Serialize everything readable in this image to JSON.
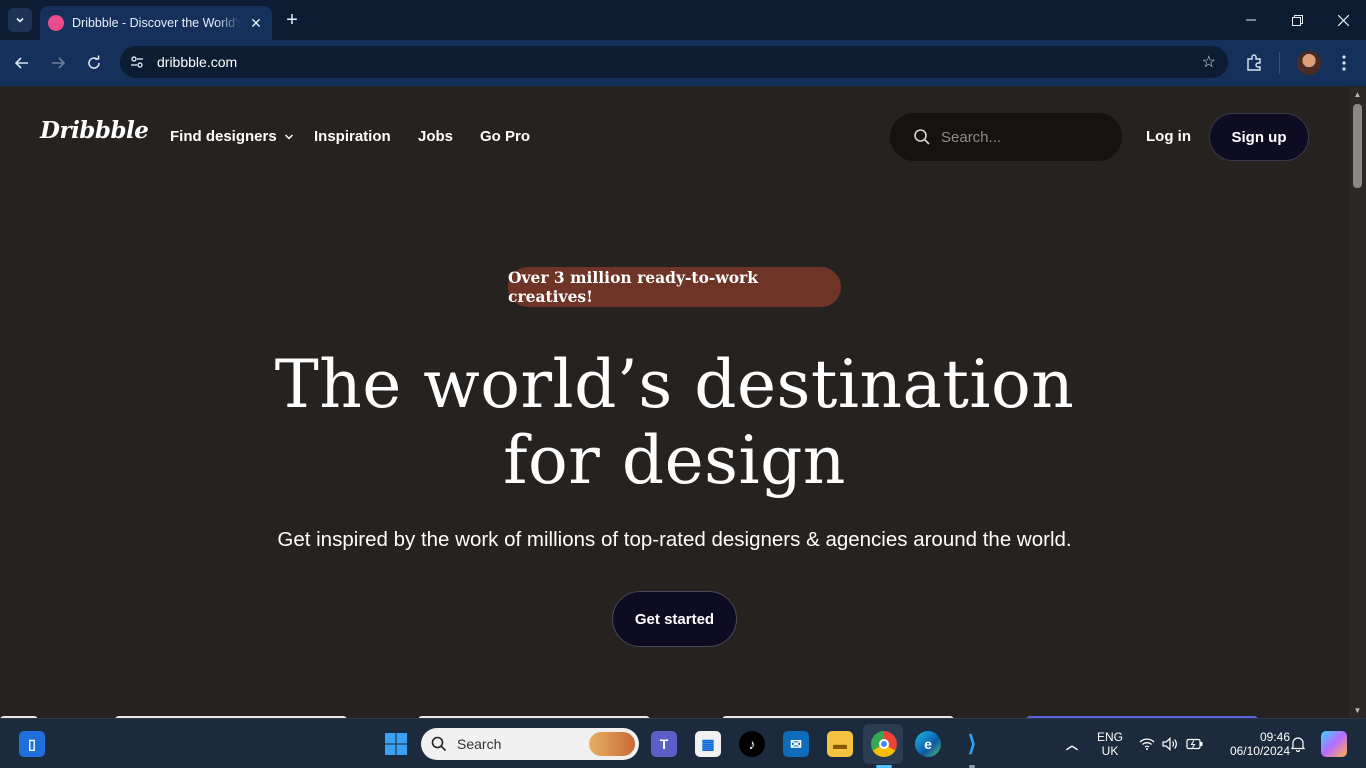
{
  "browser": {
    "tab_title": "Dribbble - Discover the World's Top Designers & Creative Professionals",
    "url": "dribbble.com"
  },
  "site": {
    "logo": "Dribbble",
    "nav": {
      "find_designers": "Find designers",
      "inspiration": "Inspiration",
      "jobs": "Jobs",
      "go_pro": "Go Pro"
    },
    "search_placeholder": "Search...",
    "login": "Log in",
    "signup": "Sign up"
  },
  "hero": {
    "pill": "Over 3 million ready-to-work creatives!",
    "headline_line1": "The world’s destination",
    "headline_line2": "for design",
    "subhead": "Get inspired by the work of millions of top-rated designers & agencies around the world.",
    "cta": "Get started"
  },
  "colors": {
    "page_bg": "#252220",
    "pill_bg": "#6e3426",
    "button_bg": "#0d0c22",
    "brand_pink": "#ea4c89"
  },
  "taskbar": {
    "search_label": "Search",
    "lang_line1": "ENG",
    "lang_line2": "UK",
    "time": "09:46",
    "date": "06/10/2024"
  }
}
